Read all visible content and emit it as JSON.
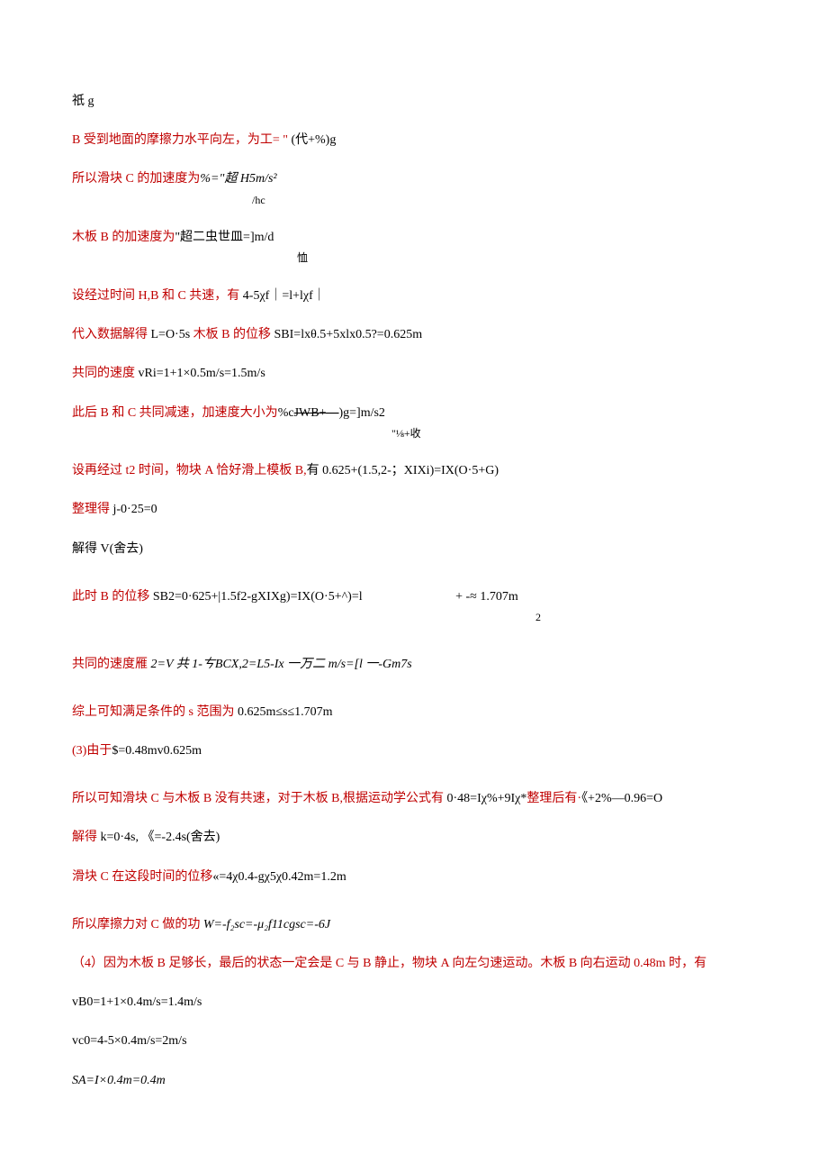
{
  "lines": {
    "l1": "祇 g",
    "l2_red": "B 受到地面的摩擦力水平向左，为工= \" ",
    "l2_black": "(代+%)g",
    "l3_red": "所以滑块 C 的加速度为",
    "l3_black": "%=\"超 H5m/s²",
    "l3_note": "/hc",
    "l4_red": "木板 B 的加速度为",
    "l4_black": "\"超二虫世皿=]m/d",
    "l4_note": "恤",
    "l5_red": "设经过时间 H,B 和 C 共速，有 ",
    "l5_black": "4-5χf｜=l+lχf｜",
    "l6_red": "代入数据解得 ",
    "l6_black1": "L=O·5s ",
    "l6_red2": "木板 B 的位移 ",
    "l6_black2": "SBI=lxθ.5+5xlx0.5?=0.625m",
    "l7_red": "共同的速度 ",
    "l7_black": "vRi=1+1×0.5m/s=1.5m/s",
    "l8_red": "此后 B 和 C 共同减速，加速度大小为",
    "l8_black1": "%c",
    "l8_strike": "JWB+—",
    "l8_black2": ")g=]m/s2",
    "l8_note": "\"⅛+收",
    "l9_red": "设再经过 t2 时间，物块 A 恰好滑上模板 B,",
    "l9_black": "有 0.625+(1.5,2-；XIXi)=IX(O·5+G)",
    "l10_red": "整理得 ",
    "l10_black": "j-0·25=0",
    "l11": "解得 V(舍去)",
    "l12_red": "此时 B 的位移 ",
    "l12_black": "SB2=0·625+|1.5f2-gXIXg)=IX(O·5+^)=l",
    "l12_right": "+ -≈ 1.707m",
    "l12_right2": "2",
    "l13_red": "共同的速度雁 ",
    "l13_black": "2=V 共 1-ㄘBCX,2=L5-Ix 一万二 m/s=[l 一-Gm7s",
    "l14_red": "综上可知满足条件的 s 范围为 ",
    "l14_black": "0.625m≤s≤1.707m",
    "l15_red": "(3)由于",
    "l15_black": "$=0.48mv0.625m",
    "l16_red": "所以可知滑块 C 与木板 B 没有共速，对于木板 B,根据运动学公式有 ",
    "l16_black": "0·48=Iχ%+9Iχ*",
    "l16_red2": "整理后有·",
    "l16_black2": "《+2%—0.96=O",
    "l17_red": "解得 ",
    "l17_black1": "k=0·4s, ",
    "l17_black2": "《=-2.4s(舍去)",
    "l18_red": "滑块 C 在这段时间的位移",
    "l18_black": "«=4χ0.4-gχ5χ0.42m=1.2m",
    "l19_red": "所以摩擦力对 C 做的功 ",
    "l19_black": "W=-f₂sc=-μ₂f11cgsc=-6J",
    "l20_red": "（4）因为木板 B 足够长，最后的状态一定会是 C 与 B 静止，物块 A 向左匀速运动。木板 B 向右运动 0.48m 时，有",
    "l21": "vB0=1+1×0.4m/s=1.4m/s",
    "l22": "vc0=4-5×0.4m/s=2m/s",
    "l23": "SA=I×0.4m=0.4m"
  }
}
